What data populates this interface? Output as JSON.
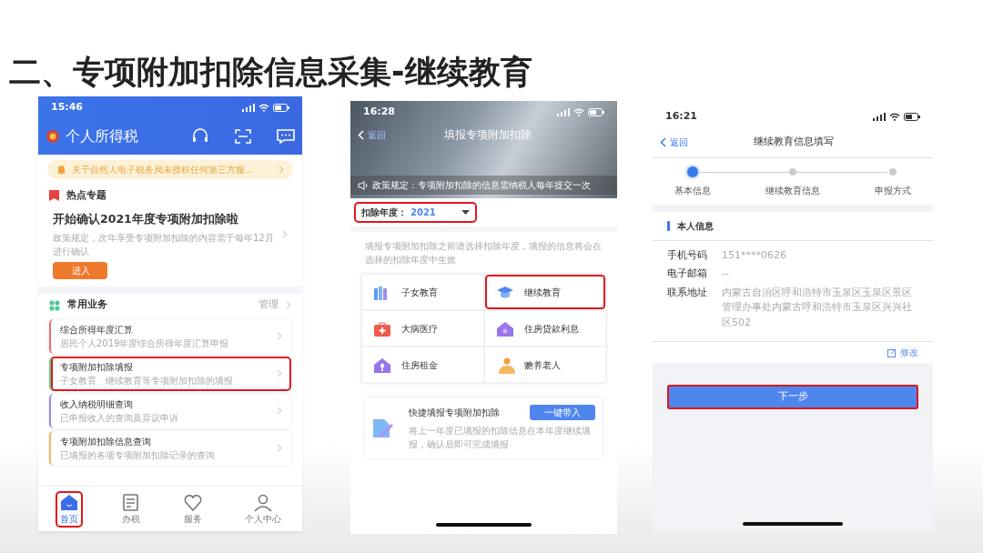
{
  "slide_title": "二、专项附加扣除信息采集-继续教育",
  "phone_home": {
    "time": "15:46",
    "app_title": "个人所得税",
    "notice": "关于自然人电子税务局未授权任何第三方服...",
    "hot_heading": "热点专题",
    "topic": {
      "title": "开始确认2021年度专项附加扣除啦",
      "desc": "政策规定，次年享受专项附加扣除的内容需于每年12月进行确认",
      "button": "进入"
    },
    "services_heading": "常用业务",
    "manage": "管理",
    "services": [
      {
        "title": "综合所得年度汇算",
        "subtitle": "居民个人2019年度综合所得年度汇算申报",
        "color": "#f06a7a",
        "highlighted": false
      },
      {
        "title": "专项附加扣除填报",
        "subtitle": "子女教育、继续教育等专项附加扣除的填报",
        "color": "#5fd08a",
        "highlighted": true
      },
      {
        "title": "收入纳税明细查询",
        "subtitle": "已申报收入的查询及异议申诉",
        "color": "#9a8cf0",
        "highlighted": false
      },
      {
        "title": "专项附加扣除信息查询",
        "subtitle": "已填报的各项专项附加扣除记录的查询",
        "color": "#f5b860",
        "highlighted": false
      }
    ],
    "tabs": [
      {
        "label": "首页",
        "kind": "home",
        "selected": true,
        "highlighted": true
      },
      {
        "label": "办税",
        "kind": "form",
        "selected": false,
        "highlighted": false
      },
      {
        "label": "服务",
        "kind": "heart",
        "selected": false,
        "highlighted": false
      },
      {
        "label": "个人中心",
        "kind": "person",
        "selected": false,
        "highlighted": false
      }
    ]
  },
  "phone_deduction": {
    "time": "16:28",
    "back": "返回",
    "title": "填报专项附加扣除",
    "banner_notice": "政策规定：专项附加扣除的信息需纳税人每年提交一次",
    "year_label": "扣除年度：",
    "year_value": "2021",
    "year_highlighted": true,
    "hint": "填报专项附加扣除之前请选择扣除年度，填报的信息将会在选择的扣除年度中生效",
    "categories": [
      {
        "label": "子女教育",
        "kind": "books",
        "highlighted": false
      },
      {
        "label": "继续教育",
        "kind": "cap",
        "highlighted": true
      },
      {
        "label": "大病医疗",
        "kind": "medkit",
        "highlighted": false
      },
      {
        "label": "住房贷款利息",
        "kind": "house",
        "highlighted": false
      },
      {
        "label": "住房租金",
        "kind": "key-house",
        "highlighted": false
      },
      {
        "label": "赡养老人",
        "kind": "elder",
        "highlighted": false
      }
    ],
    "quick": {
      "title": "快捷填报专项附加扣除",
      "button": "一键带入",
      "desc": "将上一年度已填报的扣除信息在本年度继续填报，确认后即可完成填报"
    }
  },
  "phone_education": {
    "time": "16:21",
    "back": "返回",
    "title": "继续教育信息填写",
    "steps": [
      {
        "label": "基本信息",
        "selected": true
      },
      {
        "label": "继续教育信息",
        "selected": false
      },
      {
        "label": "申报方式",
        "selected": false
      }
    ],
    "section": "本人信息",
    "fields": [
      {
        "label": "手机号码",
        "value": "151****0626"
      },
      {
        "label": "电子邮箱",
        "value": "--"
      },
      {
        "label": "联系地址",
        "value": "内蒙古自治区呼和浩特市玉泉区玉泉区景区管理办事处内蒙古呼和浩特市玉泉区兴兴社区502"
      }
    ],
    "edit": "修改",
    "next_button": "下一步",
    "next_highlighted": true
  }
}
